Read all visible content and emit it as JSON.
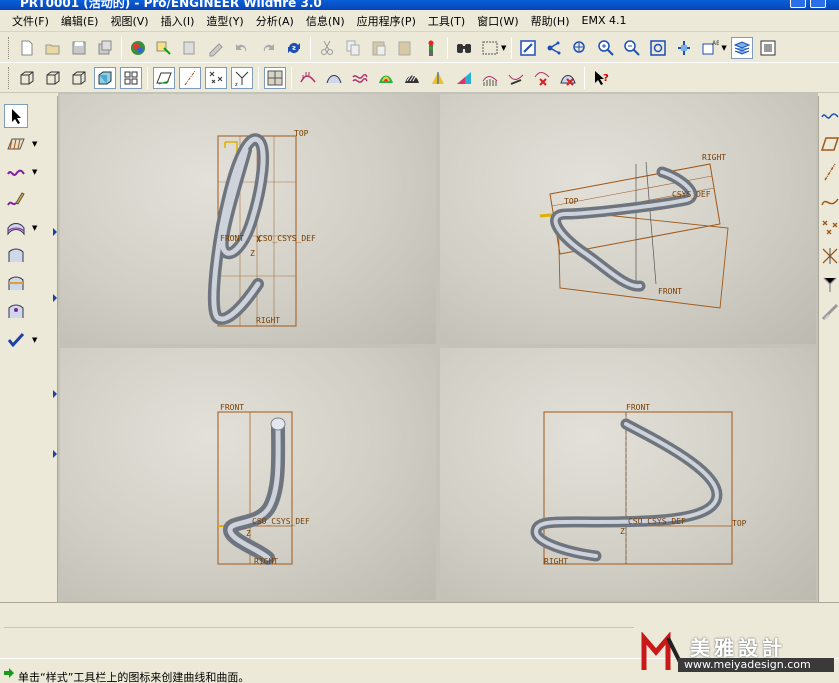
{
  "window": {
    "title": "PRT0001 (活动的) - Pro/ENGINEER Wildfire 3.0"
  },
  "menu": [
    "文件(F)",
    "编辑(E)",
    "视图(V)",
    "插入(I)",
    "造型(Y)",
    "分析(A)",
    "信息(N)",
    "应用程序(P)",
    "工具(T)",
    "窗口(W)",
    "帮助(H)",
    "EMX 4.1"
  ],
  "toolbar1": {
    "icons": [
      "new-icon",
      "open-icon",
      "save-icon",
      "save-copy-icon",
      "model-player-icon",
      "regenerate-icon",
      "edit-icon",
      "redo-edit-icon",
      "undo-icon",
      "redo-icon",
      "refresh-icon",
      "cut-icon",
      "copy-icon",
      "paste-icon",
      "paste-special-icon",
      "traffic-light-icon",
      "find-icon",
      "select-box-icon",
      "repaint-icon",
      "spin-center-icon",
      "orient-icon",
      "zoom-in-icon",
      "zoom-out-icon",
      "refit-icon",
      "reorient-icon",
      "saved-views-icon",
      "layers-icon",
      "view-manager-icon"
    ]
  },
  "toolbar2": {
    "icons": [
      "wireframe-icon",
      "hidden-line-icon",
      "no-hidden-icon",
      "shading-icon",
      "four-views-icon",
      "datum-planes-icon",
      "datum-axes-icon",
      "datum-points-icon",
      "csys-icon",
      "grid-icon",
      "curve-analysis-icon",
      "surface-analysis-icon",
      "curvature-icon",
      "shaded-curvature-icon",
      "reflection-icon",
      "draft-icon",
      "slope-icon",
      "section-icon",
      "offset-icon",
      "deviation-icon",
      "dihedral-icon",
      "help-context-icon"
    ]
  },
  "left_toolbar": {
    "icons": [
      "select-arrow-icon",
      "plane-icon",
      "curve-icon",
      "curve-edit-icon",
      "surface-icon",
      "surface-connect-icon",
      "trim-icon",
      "surface-edit-icon",
      "checkmark-icon"
    ]
  },
  "right_toolbar": {
    "icons": [
      "sketched-curve-icon",
      "datum-plane-icon",
      "datum-axis-icon",
      "datum-curve-icon",
      "datum-point-icon",
      "offset-point-icon",
      "coordinate-system-icon",
      "analysis-feature-icon"
    ]
  },
  "viewports": [
    {
      "name": "front-view",
      "labels": [
        "TOP",
        "FRONT",
        "CSO_CSYS_DEF",
        "RIGHT",
        "Z"
      ]
    },
    {
      "name": "iso-view",
      "labels": [
        "RIGHT",
        "TOP",
        "CSYS_DEF",
        "FRONT"
      ]
    },
    {
      "name": "right-view",
      "labels": [
        "FRONT",
        "CSO_CSYS_DEF",
        "RIGHT",
        "Z"
      ]
    },
    {
      "name": "top-view",
      "labels": [
        "FRONT",
        "CSO_CSYS_DEF",
        "TOP",
        "RIGHT",
        "Z"
      ]
    }
  ],
  "status": {
    "message": "单击“样式”工具栏上的图标来创建曲线和曲面。"
  },
  "watermark": {
    "title": "美雅設計",
    "url": "www.meiyadesign.com"
  },
  "colors": {
    "datum": "#a0581a",
    "csys": "#7a3e00",
    "tube_light": "#d9dde4",
    "tube_dark": "#7d838c"
  }
}
